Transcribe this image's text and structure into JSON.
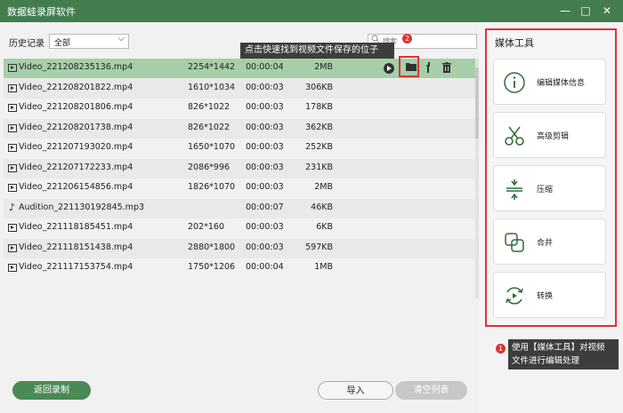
{
  "window": {
    "title": "数据蛙录屏软件",
    "minimize": "—",
    "maximize": "□",
    "close": "✕"
  },
  "history": {
    "label": "历史记录",
    "filter_value": "全部",
    "chevron": "⌵"
  },
  "search": {
    "placeholder": "搜索",
    "icon": "search-icon"
  },
  "tooltips": {
    "folder_hint": "点击快速找到视频文件保存的位子",
    "folder_badge": "2",
    "media_hint_line1": "使用【媒体工具】对视频",
    "media_hint_line2": "文件进行编辑处理",
    "media_badge": "1"
  },
  "files": [
    {
      "name": "Video_221208235136.mp4",
      "resolution": "2254*1442",
      "duration": "00:00:04",
      "size": "2MB",
      "type": "video"
    },
    {
      "name": "Video_221208201822.mp4",
      "resolution": "1610*1034",
      "duration": "00:00:03",
      "size": "306KB",
      "type": "video"
    },
    {
      "name": "Video_221208201806.mp4",
      "resolution": "826*1022",
      "duration": "00:00:03",
      "size": "178KB",
      "type": "video"
    },
    {
      "name": "Video_221208201738.mp4",
      "resolution": "826*1022",
      "duration": "00:00:03",
      "size": "362KB",
      "type": "video"
    },
    {
      "name": "Video_221207193020.mp4",
      "resolution": "1650*1070",
      "duration": "00:00:03",
      "size": "252KB",
      "type": "video"
    },
    {
      "name": "Video_221207172233.mp4",
      "resolution": "2086*996",
      "duration": "00:00:03",
      "size": "231KB",
      "type": "video"
    },
    {
      "name": "Video_221206154856.mp4",
      "resolution": "1826*1070",
      "duration": "00:00:03",
      "size": "2MB",
      "type": "video"
    },
    {
      "name": "Audition_221130192845.mp3",
      "resolution": "",
      "duration": "00:00:07",
      "size": "46KB",
      "type": "audio"
    },
    {
      "name": "Video_221118185451.mp4",
      "resolution": "202*160",
      "duration": "00:00:03",
      "size": "6KB",
      "type": "video"
    },
    {
      "name": "Video_221118151438.mp4",
      "resolution": "2880*1800",
      "duration": "00:00:03",
      "size": "597KB",
      "type": "video"
    },
    {
      "name": "Video_221117153754.mp4",
      "resolution": "1750*1206",
      "duration": "00:00:04",
      "size": "1MB",
      "type": "video"
    }
  ],
  "row_actions": {
    "play": "play-icon",
    "folder": "folder-icon",
    "edit": "wrench-icon",
    "delete": "trash-icon"
  },
  "media_tools": {
    "title": "媒体工具",
    "items": [
      {
        "label": "编辑媒体信息",
        "icon": "info-icon"
      },
      {
        "label": "高级剪辑",
        "icon": "scissors-icon"
      },
      {
        "label": "压缩",
        "icon": "compress-icon"
      },
      {
        "label": "合并",
        "icon": "merge-icon"
      },
      {
        "label": "转换",
        "icon": "convert-icon"
      }
    ]
  },
  "buttons": {
    "back": "返回录制",
    "import": "导入",
    "clear": "清空列表"
  },
  "colors": {
    "titlebar": "#437d4f",
    "selected_row": "#a6cfa9",
    "primary_button": "#4a8a56",
    "highlight": "#e03131"
  }
}
